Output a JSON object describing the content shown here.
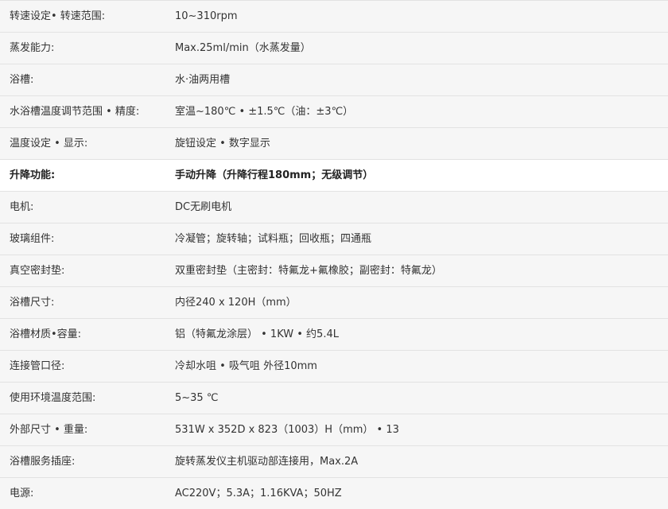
{
  "rows": [
    {
      "label": "转速设定• 转速范围:",
      "value": "10~310rpm",
      "highlight": false
    },
    {
      "label": "蒸发能力:",
      "value": "Max.25ml/min（水蒸发量）",
      "highlight": false
    },
    {
      "label": "浴槽:",
      "value": "水·油两用槽",
      "highlight": false
    },
    {
      "label": "水浴槽温度调节范围 • 精度:",
      "value": "室温~180℃ • ±1.5℃（油：±3℃）",
      "highlight": false
    },
    {
      "label": "温度设定 • 显示:",
      "value": "旋钮设定 • 数字显示",
      "highlight": false
    },
    {
      "label": "升降功能:",
      "value": "手动升降（升降行程180mm；无级调节）",
      "highlight": true
    },
    {
      "label": "电机:",
      "value": "DC无刷电机",
      "highlight": false
    },
    {
      "label": "玻璃组件:",
      "value": "冷凝管；旋转轴；试料瓶；回收瓶；四通瓶",
      "highlight": false
    },
    {
      "label": "真空密封垫:",
      "value": "双重密封垫（主密封：特氟龙+氟橡胶；副密封：特氟龙）",
      "highlight": false
    },
    {
      "label": "浴槽尺寸:",
      "value": "内径240 x 120H（mm）",
      "highlight": false
    },
    {
      "label": "浴槽材质•容量:",
      "value": "铝（特氟龙涂层） • 1KW • 约5.4L",
      "highlight": false
    },
    {
      "label": "连接管口径:",
      "value": "冷却水咀 • 吸气咀  外径10mm",
      "highlight": false
    },
    {
      "label": "使用环境温度范围:",
      "value": "5~35 ℃",
      "highlight": false
    },
    {
      "label": "外部尺寸 •  重量:",
      "value": "531W x 352D x 823（1003）H（mm）  • 13",
      "highlight": false
    },
    {
      "label": "浴槽服务插座:",
      "value": "旋转蒸发仪主机驱动部连接用，Max.2A",
      "highlight": false
    },
    {
      "label": "电源:",
      "value": "AC220V；5.3A；1.16KVA；50HZ",
      "highlight": false
    }
  ]
}
